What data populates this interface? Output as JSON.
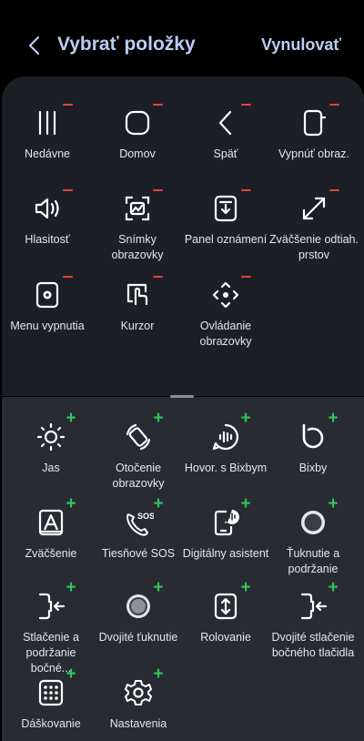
{
  "header": {
    "title": "Vybrať položky",
    "reset_label": "Vynulovať"
  },
  "selected_items": [
    {
      "label": "Nedávne",
      "icon": "recents-icon"
    },
    {
      "label": "Domov",
      "icon": "home-icon"
    },
    {
      "label": "Späť",
      "icon": "back-icon"
    },
    {
      "label": "Vypnúť obraz.",
      "icon": "screen-off-icon"
    },
    {
      "label": "Hlasitosť",
      "icon": "volume-icon"
    },
    {
      "label": "Snímky obrazovky",
      "icon": "screenshot-icon"
    },
    {
      "label": "Panel oznámení",
      "icon": "notification-panel-icon"
    },
    {
      "label": "Zväčšenie odtiah. prstov",
      "icon": "pinch-zoom-icon"
    },
    {
      "label": "Menu vypnutia",
      "icon": "power-menu-icon"
    },
    {
      "label": "Kurzor",
      "icon": "cursor-icon"
    },
    {
      "label": "Ovládanie obrazovky",
      "icon": "screen-control-icon"
    }
  ],
  "available_items": [
    {
      "label": "Jas",
      "icon": "brightness-icon"
    },
    {
      "label": "Otočenie obrazovky",
      "icon": "rotate-icon"
    },
    {
      "label": "Hovor. s Bixbym",
      "icon": "bixby-voice-icon"
    },
    {
      "label": "Bixby",
      "icon": "bixby-icon"
    },
    {
      "label": "Zväčšenie",
      "icon": "magnify-icon"
    },
    {
      "label": "Tiesňové SOS",
      "icon": "sos-icon"
    },
    {
      "label": "Digitálny asistent",
      "icon": "assistant-icon"
    },
    {
      "label": "Ťuknutie a podržanie",
      "icon": "tap-hold-icon"
    },
    {
      "label": "Stlačenie a podržanie bočné...",
      "icon": "side-press-hold-icon"
    },
    {
      "label": "Dvojité ťuknutie",
      "icon": "double-tap-icon"
    },
    {
      "label": "Rolovanie",
      "icon": "scroll-icon"
    },
    {
      "label": "Dvojité stlačenie bočného tlačidla",
      "icon": "side-double-press-icon"
    },
    {
      "label": "Dáškovanie",
      "icon": "keypad-icon"
    },
    {
      "label": "Nastavenia",
      "icon": "settings-icon"
    }
  ],
  "colors": {
    "accent": "#b9cdf5",
    "remove": "#e0463e",
    "add": "#34c45a",
    "top_panel": "#1c1f26",
    "bottom_panel": "#282b32"
  }
}
